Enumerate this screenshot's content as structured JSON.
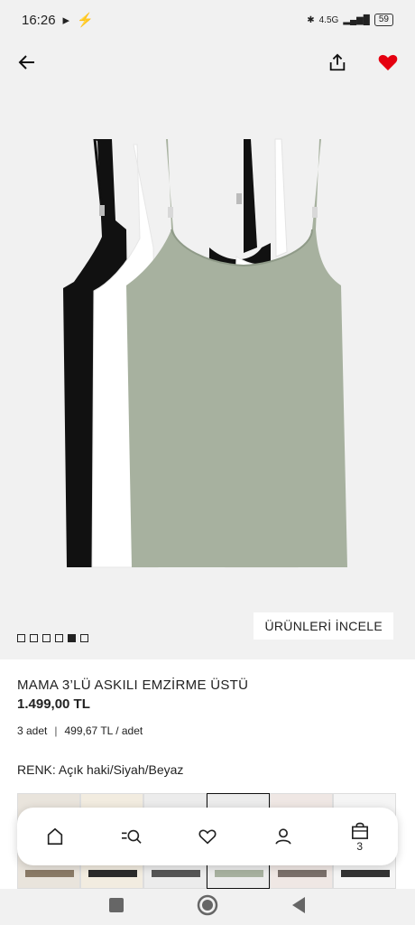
{
  "status_bar": {
    "time": "16:26",
    "network": "4.5G",
    "battery": "59"
  },
  "header": {
    "back_icon": "arrow-left-icon",
    "share_icon": "share-icon",
    "favorite_icon": "heart-filled-icon",
    "favorite_color": "#e50010"
  },
  "hero": {
    "review_label": "ÜRÜNLERİ İNCELE",
    "image_count": 6,
    "active_image": 5,
    "garment_colors": [
      "#111111",
      "#ffffff",
      "#a7b19f"
    ]
  },
  "product": {
    "title": "MAMA 3’LÜ ASKILI EMZİRME ÜSTÜ",
    "price": "1.499,00 TL",
    "quantity": "3 adet",
    "unit_price": "499,67 TL / adet",
    "separator": "|"
  },
  "color": {
    "label": "RENK: Açık haki/Siyah/Beyaz",
    "swatch_count": 6,
    "selected_index": 3
  },
  "bottom_nav": {
    "items": [
      {
        "name": "home",
        "icon": "home-icon"
      },
      {
        "name": "search",
        "icon": "search-icon"
      },
      {
        "name": "favorites",
        "icon": "heart-icon"
      },
      {
        "name": "account",
        "icon": "user-icon"
      },
      {
        "name": "cart",
        "icon": "bag-icon"
      }
    ],
    "cart_count": "3"
  },
  "system_nav": {
    "recents_icon": "square-icon",
    "home_icon": "circle-icon",
    "back_icon": "triangle-back-icon"
  }
}
